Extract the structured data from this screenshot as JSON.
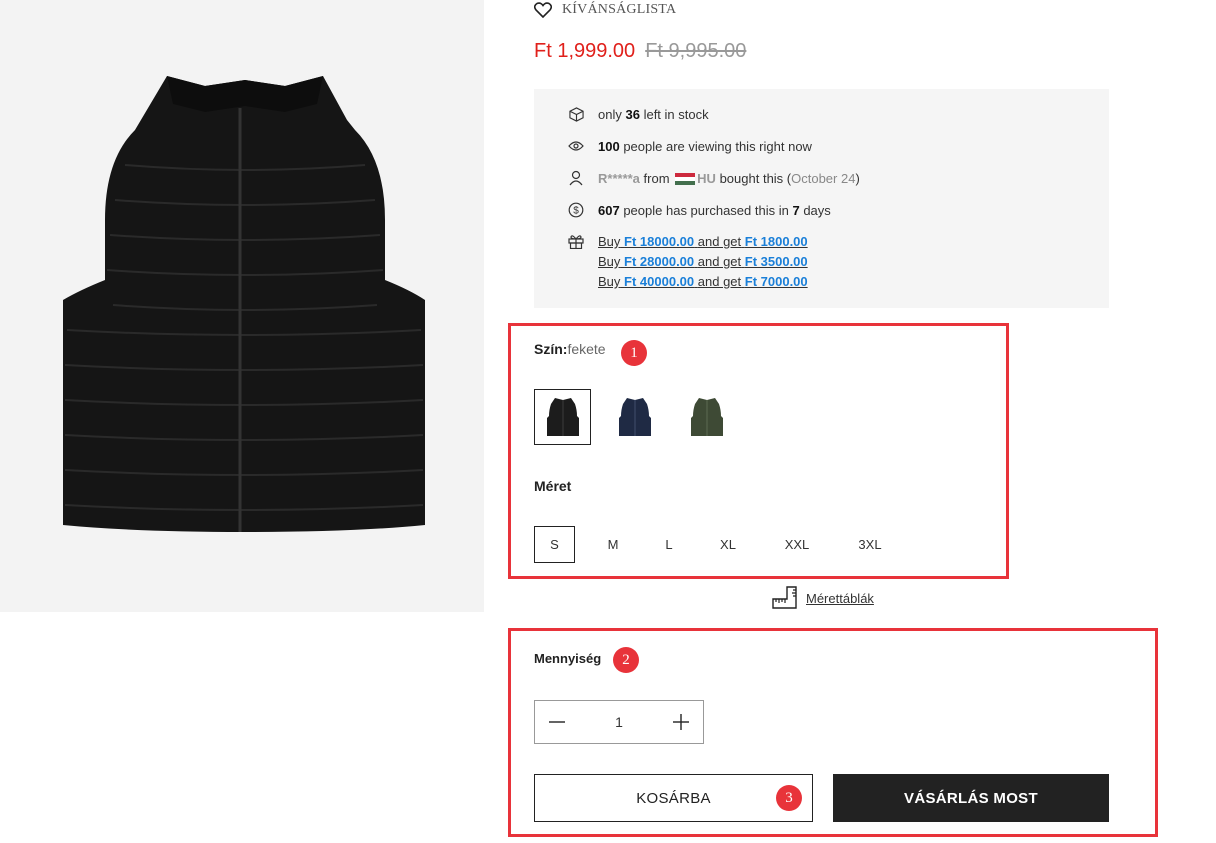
{
  "wishlist": {
    "label": "KÍVÁNSÁGLISTA",
    "icon": "heart-icon"
  },
  "price": {
    "current": "Ft 1,999.00",
    "original": "Ft 9,995.00",
    "current_color": "#e0201b"
  },
  "info": {
    "stock": {
      "prefix": "only",
      "count": "36",
      "suffix": "left in stock"
    },
    "viewing": {
      "count": "100",
      "suffix": "people are viewing this right now"
    },
    "recent": {
      "name": "R*****a",
      "from": "from",
      "country": "HU",
      "action": "bought this (",
      "date": "October 24",
      "close": ")"
    },
    "purchased": {
      "count": "607",
      "middle": "people has purchased this in",
      "days": "7",
      "suffix": "days"
    },
    "promos": [
      {
        "buy": "Buy",
        "amount": "Ft 18000.00",
        "and": "and get",
        "reward": "Ft 1800.00"
      },
      {
        "buy": "Buy",
        "amount": "Ft 28000.00",
        "and": "and get",
        "reward": "Ft 3500.00"
      },
      {
        "buy": "Buy",
        "amount": "Ft 40000.00",
        "and": "and get",
        "reward": "Ft 7000.00"
      }
    ]
  },
  "color": {
    "label": "Szín:",
    "value": "fekete",
    "swatches": [
      {
        "name": "black",
        "color": "#1c1c1c"
      },
      {
        "name": "navy",
        "color": "#1f2a44"
      },
      {
        "name": "olive",
        "color": "#3e4a35"
      }
    ]
  },
  "size": {
    "label": "Méret",
    "options": [
      "S",
      "M",
      "L",
      "XL",
      "XXL",
      "3XL"
    ],
    "selected": "S"
  },
  "size_chart": {
    "label": "Mérettáblák"
  },
  "quantity": {
    "label": "Mennyiség",
    "value": "1"
  },
  "buttons": {
    "cart": "KOSÁRBA",
    "buy_now": "VÁSÁRLÁS MOST"
  },
  "annotations": [
    "1",
    "2",
    "3"
  ],
  "accent": "#e8333a"
}
